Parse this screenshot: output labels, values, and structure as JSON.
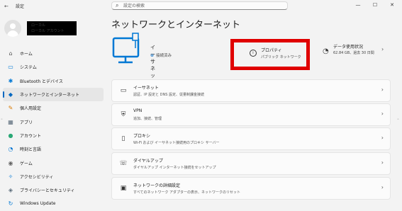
{
  "window": {
    "title": "設定",
    "minimize": "—",
    "maximize": "☐",
    "close": "✕"
  },
  "search": {
    "placeholder": "設定の検索"
  },
  "profile": {
    "name_redacted": "ローカル",
    "email_redacted": "ローカル アカウント"
  },
  "sidebar": {
    "items": [
      {
        "label": "ホーム",
        "icon": "⌂",
        "icon_name": "home-icon"
      },
      {
        "label": "システム",
        "icon": "▭",
        "icon_name": "system-icon"
      },
      {
        "label": "Bluetooth とデバイス",
        "icon": "✱",
        "icon_name": "bluetooth-icon"
      },
      {
        "label": "ネットワークとインターネット",
        "icon": "◆",
        "icon_name": "network-icon",
        "selected": true
      },
      {
        "label": "個人用設定",
        "icon": "✎",
        "icon_name": "personalization-icon"
      },
      {
        "label": "アプリ",
        "icon": "▦",
        "icon_name": "apps-icon"
      },
      {
        "label": "アカウント",
        "icon": "●",
        "icon_name": "accounts-icon"
      },
      {
        "label": "時刻と言語",
        "icon": "◔",
        "icon_name": "time-language-icon"
      },
      {
        "label": "ゲーム",
        "icon": "◉",
        "icon_name": "gaming-icon"
      },
      {
        "label": "アクセシビリティ",
        "icon": "✧",
        "icon_name": "accessibility-icon"
      },
      {
        "label": "プライバシーとセキュリティ",
        "icon": "◈",
        "icon_name": "privacy-icon"
      },
      {
        "label": "Windows Update",
        "icon": "↻",
        "icon_name": "windows-update-icon"
      }
    ]
  },
  "main": {
    "title": "ネットワークとインターネット",
    "hero": {
      "name": "イーサネット",
      "status": "接続済み"
    },
    "properties": {
      "title": "プロパティ",
      "subtitle": "パブリック ネットワーク"
    },
    "data_usage": {
      "title": "データ使用状況",
      "subtitle": "62.84 GB、過去 30 日間"
    },
    "cards": [
      {
        "title": "イーサネット",
        "subtitle": "認証、IP 設定と DNS 設定、従量制課金接続",
        "icon": "▭",
        "icon_name": "ethernet-icon"
      },
      {
        "title": "VPN",
        "subtitle": "追加、接続、管理",
        "icon": "⛨",
        "icon_name": "vpn-icon"
      },
      {
        "title": "プロキシ",
        "subtitle": "Wi-Fi および イーサネット接続用のプロキシ サーバー",
        "icon": "▯",
        "icon_name": "proxy-icon"
      },
      {
        "title": "ダイヤルアップ",
        "subtitle": "ダイヤルアップ インターネット接続をセットアップ",
        "icon": "☏",
        "icon_name": "dialup-icon"
      },
      {
        "title": "ネットワークの詳細設定",
        "subtitle": "すべてのネットワーク アダプターの表示、ネットワークのリセット",
        "icon": "▣",
        "icon_name": "advanced-network-icon"
      }
    ]
  },
  "colors": {
    "accent": "#0067c0",
    "highlight": "#e00000",
    "background": "#f3f3f3"
  }
}
